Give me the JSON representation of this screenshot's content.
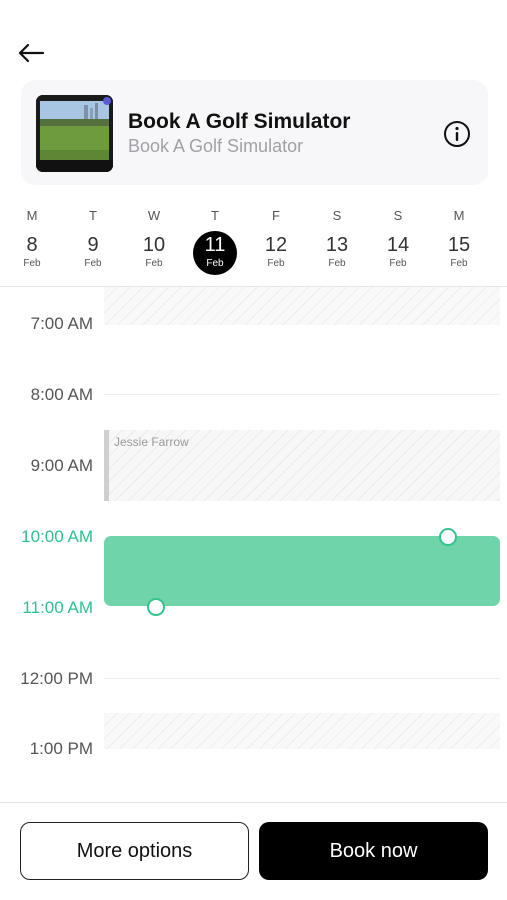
{
  "venue": {
    "title": "Book A Golf Simulator",
    "subtitle": "Book A Golf Simulator"
  },
  "days": [
    {
      "dow": "M",
      "num": "8",
      "month": "Feb",
      "selected": false
    },
    {
      "dow": "T",
      "num": "9",
      "month": "Feb",
      "selected": false
    },
    {
      "dow": "W",
      "num": "10",
      "month": "Feb",
      "selected": false
    },
    {
      "dow": "T",
      "num": "11",
      "month": "Feb",
      "selected": true
    },
    {
      "dow": "F",
      "num": "12",
      "month": "Feb",
      "selected": false
    },
    {
      "dow": "S",
      "num": "13",
      "month": "Feb",
      "selected": false
    },
    {
      "dow": "S",
      "num": "14",
      "month": "Feb",
      "selected": false
    },
    {
      "dow": "M",
      "num": "15",
      "month": "Feb",
      "selected": false
    }
  ],
  "timeline": {
    "hours": [
      "7:00 AM",
      "8:00 AM",
      "9:00 AM",
      "10:00 AM",
      "11:00 AM",
      "12:00 PM",
      "1:00 PM"
    ],
    "highlighted_hours": [
      "10:00 AM",
      "11:00 AM"
    ],
    "existing_booking": {
      "name": "Jessie Farrow",
      "start": "9:00 AM",
      "end": "10:00 AM"
    },
    "selected_slot": {
      "start": "10:00 AM",
      "end": "11:00 AM"
    }
  },
  "actions": {
    "more_options": "More options",
    "book_now": "Book now"
  },
  "colors": {
    "accent": "#2fc18c",
    "selection_fill": "#6fd4a9",
    "primary_button": "#000000",
    "selected_day": "#000000"
  },
  "icons": {
    "back": "arrow-left-icon",
    "info": "info-circle-icon"
  }
}
